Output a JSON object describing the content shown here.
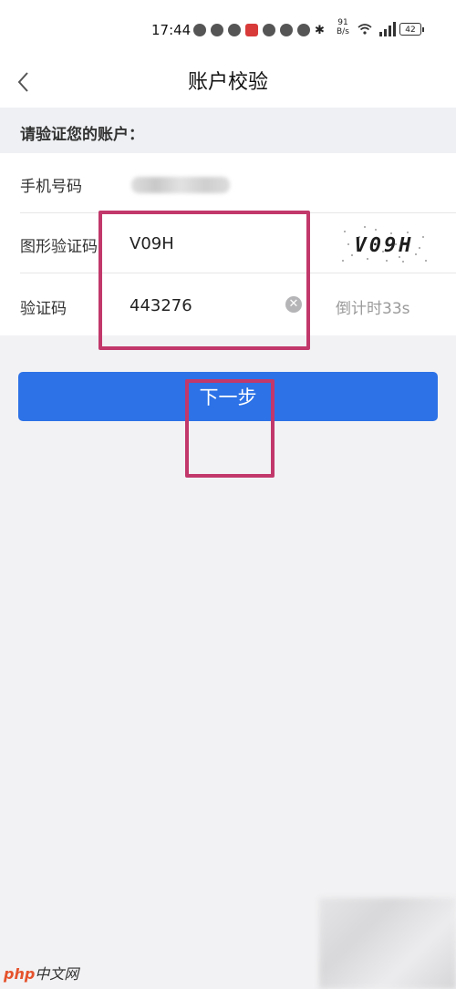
{
  "status_bar": {
    "time": "17:44",
    "net_speed_value": "91",
    "net_speed_unit": "B/s",
    "battery": "42"
  },
  "nav": {
    "title": "账户校验"
  },
  "section": {
    "header": "请验证您的账户："
  },
  "form": {
    "phone_label": "手机号码",
    "captcha_label": "图形验证码",
    "captcha_value": "V09H",
    "captcha_image_text": "V09H",
    "code_label": "验证码",
    "code_value": "443276",
    "countdown": "倒计时33s"
  },
  "actions": {
    "next_label": "下一步"
  },
  "watermark": {
    "brand": "php",
    "site": "中文网"
  },
  "colors": {
    "primary": "#2d72e6",
    "highlight": "#c2386a",
    "background": "#f2f2f4"
  }
}
